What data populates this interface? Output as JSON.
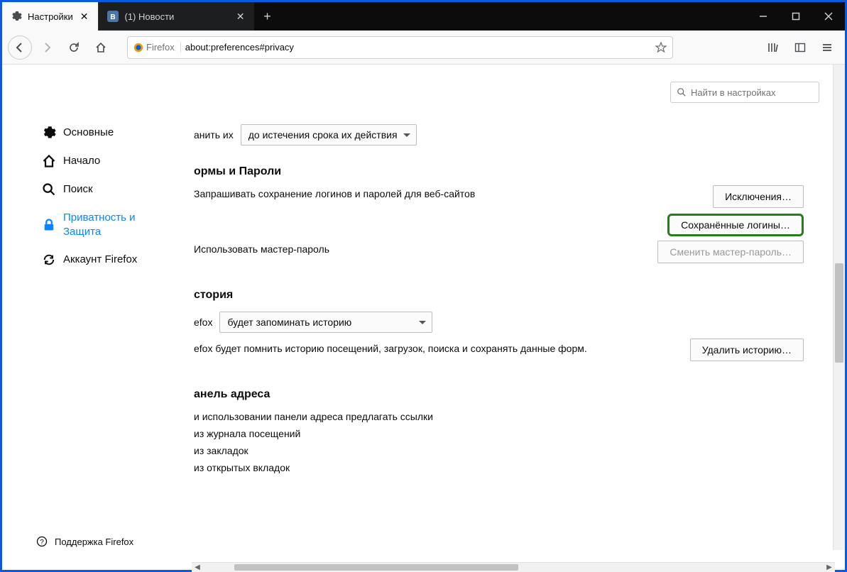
{
  "window": {
    "tabs": [
      {
        "title": "Настройки",
        "icon": "gear",
        "active": true
      },
      {
        "title": "(1) Новости",
        "icon": "vk",
        "active": false
      }
    ]
  },
  "toolbar": {
    "identity_label": "Firefox",
    "url": "about:preferences#privacy"
  },
  "search_settings_placeholder": "Найти в настройках",
  "sidebar": {
    "items": [
      {
        "id": "general",
        "label": "Основные"
      },
      {
        "id": "home",
        "label": "Начало"
      },
      {
        "id": "search",
        "label": "Поиск"
      },
      {
        "id": "privacy",
        "label": "Приватность и Защита"
      },
      {
        "id": "sync",
        "label": "Аккаунт Firefox"
      }
    ],
    "support_label": "Поддержка Firefox"
  },
  "prefs": {
    "cookies": {
      "label_fragment": "анить их",
      "dropdown_value": "до истечения срока их действия"
    },
    "forms_section_title": "ормы и Пароли",
    "ask_save_logins": "Запрашивать сохранение логинов и паролей для веб-сайтов",
    "exceptions_btn": "Исключения…",
    "saved_logins_btn": "Сохранённые логины…",
    "use_master_password": "Использовать мастер-пароль",
    "change_master_password_btn": "Сменить мастер-пароль…",
    "history_section_title": "стория",
    "history_prefix": "efox",
    "history_dropdown_value": "будет запоминать историю",
    "history_desc": "efox будет помнить историю посещений, загрузок, поиска и сохранять данные форм.",
    "clear_history_btn": "Удалить историю…",
    "addressbar_section_title": "анель адреса",
    "addressbar_intro": "и использовании панели адреса предлагать ссылки",
    "addressbar_opts": [
      "из журнала посещений",
      "из закладок",
      "из открытых вкладок"
    ]
  },
  "colors": {
    "accent": "#0a84ff",
    "highlight_border": "#2b7a1f"
  }
}
